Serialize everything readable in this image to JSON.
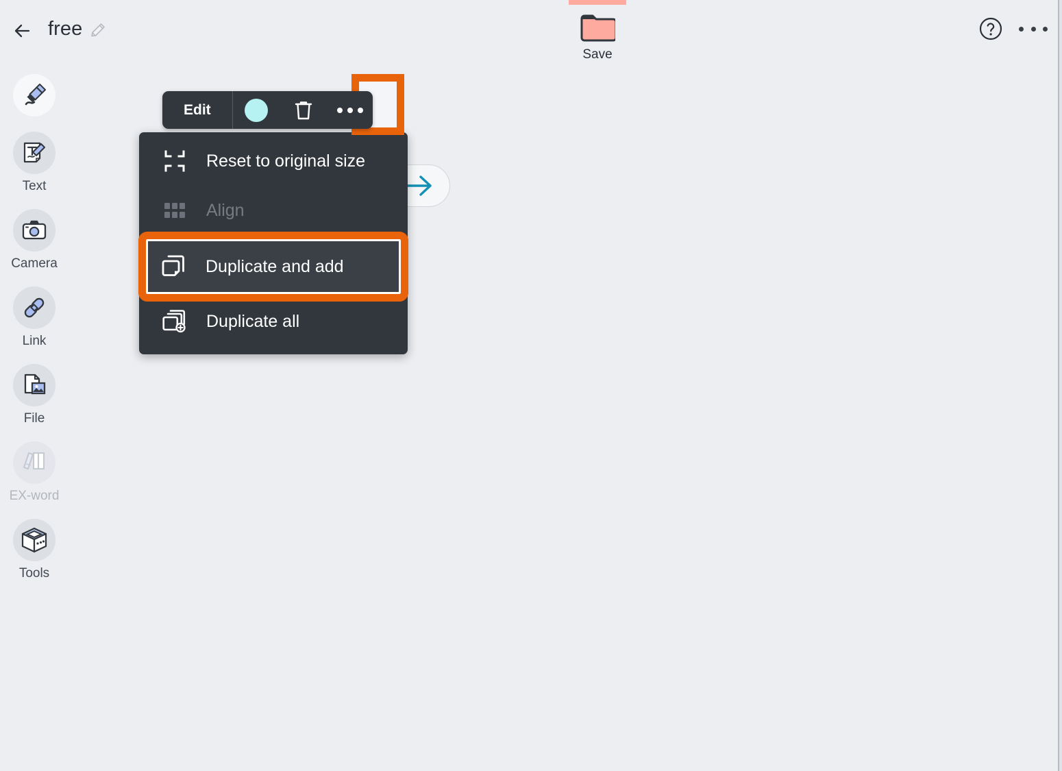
{
  "app": {
    "background_color": "#eceef2",
    "accent_highlight_color": "#e8630a",
    "toolbar_bg_color": "#32373e",
    "tab_color": "#ffaa9e"
  },
  "header": {
    "back_icon": "back-arrow-icon",
    "title": "free",
    "edit_title_icon": "pencil-icon",
    "save": {
      "label": "Save",
      "icon": "folder-icon",
      "tab_color": "#ffaa9e"
    },
    "help_icon": "question-circle-icon",
    "overflow_icon": "more-horizontal-icon"
  },
  "sidebar": {
    "items": [
      {
        "label": "",
        "icon": "marker-pen-icon",
        "disabled": false,
        "selected": true
      },
      {
        "label": "Text",
        "icon": "text-edit-icon",
        "disabled": false,
        "selected": false
      },
      {
        "label": "Camera",
        "icon": "camera-icon",
        "disabled": false,
        "selected": false
      },
      {
        "label": "Link",
        "icon": "link-chain-icon",
        "disabled": false,
        "selected": false
      },
      {
        "label": "File",
        "icon": "file-image-icon",
        "disabled": false,
        "selected": false
      },
      {
        "label": "EX-word",
        "icon": "books-icon",
        "disabled": true,
        "selected": false
      },
      {
        "label": "Tools",
        "icon": "toolbox-cube-icon",
        "disabled": false,
        "selected": false
      }
    ]
  },
  "object_toolbar": {
    "edit_label": "Edit",
    "color_swatch": "#b6f2f2",
    "color_icon": "color-circle-icon",
    "delete_icon": "trash-icon",
    "more_icon": "more-horizontal-icon",
    "more_highlighted": true
  },
  "canvas": {
    "arrow_button_icon": "arrow-right-icon",
    "arrow_button_color": "#1391b5"
  },
  "context_menu": {
    "items": [
      {
        "label": "Reset to original size",
        "icon": "collapse-corners-icon",
        "disabled": false,
        "highlighted": false
      },
      {
        "label": "Align",
        "icon": "grid-align-icon",
        "disabled": true,
        "highlighted": false
      },
      {
        "label": "Duplicate and add",
        "icon": "duplicate-icon",
        "disabled": false,
        "highlighted": true
      },
      {
        "label": "Duplicate all",
        "icon": "duplicate-all-icon",
        "disabled": false,
        "highlighted": false
      }
    ]
  }
}
